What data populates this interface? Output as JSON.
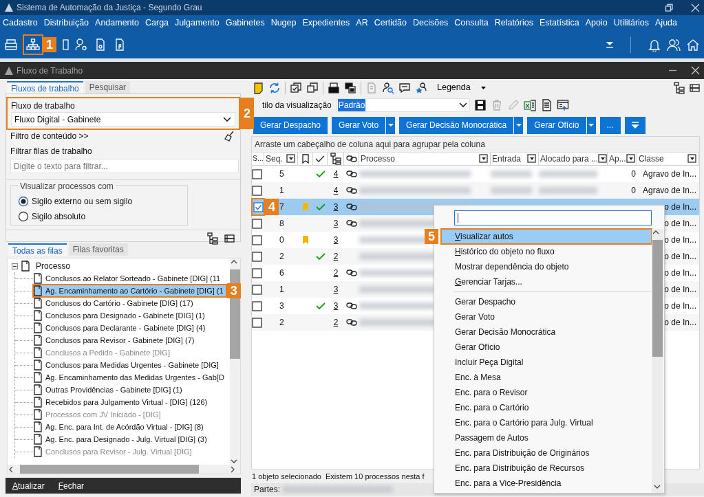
{
  "app": {
    "title": "Sistema de Automação da Justiça - Segundo Grau",
    "menu": [
      "Cadastro",
      "Distribuição",
      "Andamento",
      "Carga",
      "Julgamento",
      "Gabinetes",
      "Nugep",
      "Expedientes",
      "AR",
      "Certidão",
      "Decisões",
      "Consulta",
      "Relatórios",
      "Estatística",
      "Apoio",
      "Utilitários",
      "Ajuda"
    ],
    "toolbar": {
      "callout": "1"
    }
  },
  "window": {
    "title": "Fluxo de Trabalho"
  },
  "left_panel": {
    "tabs": [
      {
        "label": "Fluxos de trabalho",
        "selected": true
      },
      {
        "label": "Pesquisar",
        "selected": false
      }
    ],
    "workflow": {
      "label": "Fluxo de trabalho",
      "value": "Fluxo Digital - Gabinete",
      "callout": "2"
    },
    "content_filter": "Filtro de conteúdo >>",
    "queue_filter": {
      "label": "Filtrar filas de trabalho",
      "placeholder": "Digite o texto para filtrar..."
    },
    "visibility": {
      "legend": "Visualizar processos com",
      "options": [
        {
          "label": "Sigilo externo ou sem sigilo",
          "selected": true
        },
        {
          "label": "Sigilo absoluto",
          "selected": false
        }
      ]
    },
    "queue_tabs": [
      {
        "label": "Todas as filas",
        "selected": true
      },
      {
        "label": "Filas favoritas",
        "selected": false
      }
    ],
    "tree": {
      "label": "Processo",
      "expanded": true,
      "children": [
        {
          "label": "Conclusos ao Relator Sorteado - Gabinete [DIG] (11",
          "disabled": false,
          "selected": false
        },
        {
          "label": "Ag. Encaminhamento ao Cartório - Gabinete [DIG] (1",
          "disabled": false,
          "selected": true,
          "callout": "3"
        },
        {
          "label": "Conclusos do Cartório - Gabinete [DIG] (17)",
          "disabled": false,
          "selected": false
        },
        {
          "label": "Conclusos para Designado - Gabinete [DIG] (1)",
          "disabled": false,
          "selected": false
        },
        {
          "label": "Conclusos para Declarante - Gabinete [DIG] (4)",
          "disabled": false,
          "selected": false
        },
        {
          "label": "Conclusos para Revisor - Gabinete [DIG] (7)",
          "disabled": false,
          "selected": false
        },
        {
          "label": "Conclusos a Pedido - Gabinete [DIG]",
          "disabled": true,
          "selected": false
        },
        {
          "label": "Conclusos para Medidas Urgentes - Gabinete [DIG]",
          "disabled": false,
          "selected": false
        },
        {
          "label": "Ag. Encaminhamento das Medidas Urgentes - Gab[D",
          "disabled": false,
          "selected": false
        },
        {
          "label": "Outras Providências - Gabinete [DIG] (1)",
          "disabled": false,
          "selected": false
        },
        {
          "label": "Recebidos para Julgamento Virtual - [DIG] (126)",
          "disabled": false,
          "selected": false
        },
        {
          "label": "Processos com JV Iniciado - [DIG]",
          "disabled": true,
          "selected": false
        },
        {
          "label": "Ag. Enc. para Int. de Acórdão Virtual - [DIG] (8)",
          "disabled": false,
          "selected": false
        },
        {
          "label": "Ag. Enc. para Designado - Julg. Virtual [DIG] (3)",
          "disabled": false,
          "selected": false
        },
        {
          "label": "Conclusos para Revisor - Julg. Virtual [DIG]",
          "disabled": true,
          "selected": false
        }
      ]
    },
    "buttons": [
      {
        "label": "Atualizar",
        "mnemonic": true
      },
      {
        "label": "Fechar",
        "mnemonic": true
      }
    ]
  },
  "right_panel": {
    "legend_label": "Legenda",
    "view_style": {
      "label": "tilo da visualização",
      "value": "Padrão"
    },
    "actions": [
      {
        "label": "Gerar Despacho",
        "split": false
      },
      {
        "label": "Gerar Voto",
        "split": true
      },
      {
        "label": "Gerar Decisão Monocrática",
        "split": true
      },
      {
        "label": "Gerar Ofício",
        "split": true
      },
      {
        "label": "...",
        "split": false
      }
    ],
    "group_hint": "Arraste um cabeçalho de coluna aqui para agrupar pela coluna",
    "columns": [
      "S...",
      "Seq.",
      "Processo",
      "Entrada",
      "Alocado para ...",
      "Ap...",
      "Classe"
    ],
    "rows": [
      {
        "checked": false,
        "selected": false,
        "seq": "5",
        "bookmarked": false,
        "done": true,
        "count": "4",
        "linked": true,
        "ap": "0",
        "classe": "Agravo de In..."
      },
      {
        "checked": false,
        "selected": false,
        "seq": "1",
        "bookmarked": false,
        "done": false,
        "count": "4",
        "linked": true,
        "ap": "0",
        "classe": "Agravo de In..."
      },
      {
        "checked": true,
        "selected": true,
        "seq": "7",
        "bookmarked": true,
        "done": true,
        "count": "3",
        "linked": true,
        "classe": "o de In...",
        "callout": "4"
      },
      {
        "checked": false,
        "selected": false,
        "seq": "8",
        "bookmarked": false,
        "done": false,
        "count": "3",
        "linked": true,
        "classe": "o de In..."
      },
      {
        "checked": false,
        "selected": false,
        "seq": "0",
        "bookmarked": true,
        "done": false,
        "count": "3",
        "linked": false,
        "classe": "o de In..."
      },
      {
        "checked": false,
        "selected": false,
        "seq": "2",
        "bookmarked": false,
        "done": true,
        "count": "2",
        "linked": false,
        "classe": "o de In..."
      },
      {
        "checked": false,
        "selected": false,
        "seq": "6",
        "bookmarked": false,
        "done": false,
        "count": "2",
        "linked": true,
        "classe": "o de In..."
      },
      {
        "checked": false,
        "selected": false,
        "seq": "1",
        "bookmarked": false,
        "done": false,
        "count": "3",
        "linked": false,
        "classe": "o de In..."
      },
      {
        "checked": false,
        "selected": false,
        "seq": "3",
        "bookmarked": false,
        "done": true,
        "count": "3",
        "linked": true,
        "classe": "o de In..."
      },
      {
        "checked": false,
        "selected": false,
        "seq": "2",
        "bookmarked": false,
        "done": false,
        "count": "2",
        "linked": true,
        "classe": "o de In..."
      }
    ],
    "status": [
      "1 objeto selecionado",
      "Existem 10 processos nesta f"
    ],
    "parties_label": "Partes:"
  },
  "context_menu": {
    "items": [
      {
        "kind": "item",
        "label": "Visualizar autos",
        "selected": true,
        "mnemonic": true,
        "callout": "5"
      },
      {
        "kind": "item",
        "label": "Histórico do objeto no fluxo",
        "selected": false,
        "mnemonic": true
      },
      {
        "kind": "item",
        "label": "Mostrar dependência do objeto",
        "selected": false,
        "mnemonic": false
      },
      {
        "kind": "item",
        "label": "Gerenciar Tarjas...",
        "selected": false,
        "mnemonic": true
      },
      {
        "kind": "separator"
      },
      {
        "kind": "item",
        "label": "Gerar Despacho",
        "selected": false,
        "mnemonic": false
      },
      {
        "kind": "item",
        "label": "Gerar Voto",
        "selected": false,
        "mnemonic": false
      },
      {
        "kind": "item",
        "label": "Gerar Decisão Monocrática",
        "selected": false,
        "mnemonic": false
      },
      {
        "kind": "item",
        "label": "Gerar Ofício",
        "selected": false,
        "mnemonic": false
      },
      {
        "kind": "item",
        "label": "Incluir Peça Digital",
        "selected": false,
        "mnemonic": false
      },
      {
        "kind": "item",
        "label": "Enc. à Mesa",
        "selected": false,
        "mnemonic": false
      },
      {
        "kind": "item",
        "label": "Enc. para o Revisor",
        "selected": false,
        "mnemonic": false
      },
      {
        "kind": "item",
        "label": "Enc. para o Cartório",
        "selected": false,
        "mnemonic": false
      },
      {
        "kind": "item",
        "label": "Enc. para o Cartório para Julg. Virtual",
        "selected": false,
        "mnemonic": false
      },
      {
        "kind": "item",
        "label": "Passagem de Autos",
        "selected": false,
        "mnemonic": false
      },
      {
        "kind": "item",
        "label": "Enc. para Distribuição de Originários",
        "selected": false,
        "mnemonic": false
      },
      {
        "kind": "item",
        "label": "Enc. para Distribuição de Recursos",
        "selected": false,
        "mnemonic": false
      },
      {
        "kind": "item",
        "label": "Enc. para a Vice-Presidência",
        "selected": false,
        "mnemonic": false
      }
    ]
  }
}
